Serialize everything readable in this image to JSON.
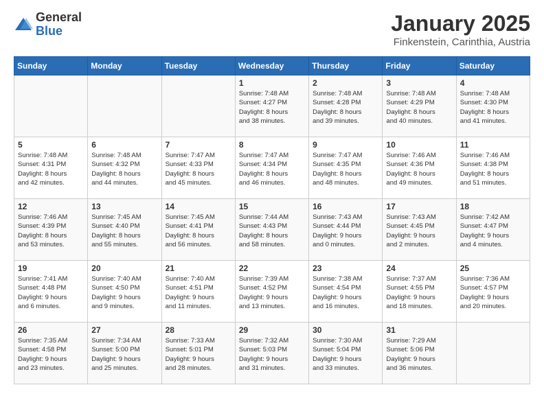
{
  "header": {
    "logo_general": "General",
    "logo_blue": "Blue",
    "title": "January 2025",
    "location": "Finkenstein, Carinthia, Austria"
  },
  "weekdays": [
    "Sunday",
    "Monday",
    "Tuesday",
    "Wednesday",
    "Thursday",
    "Friday",
    "Saturday"
  ],
  "weeks": [
    [
      {
        "day": "",
        "info": ""
      },
      {
        "day": "",
        "info": ""
      },
      {
        "day": "",
        "info": ""
      },
      {
        "day": "1",
        "info": "Sunrise: 7:48 AM\nSunset: 4:27 PM\nDaylight: 8 hours\nand 38 minutes."
      },
      {
        "day": "2",
        "info": "Sunrise: 7:48 AM\nSunset: 4:28 PM\nDaylight: 8 hours\nand 39 minutes."
      },
      {
        "day": "3",
        "info": "Sunrise: 7:48 AM\nSunset: 4:29 PM\nDaylight: 8 hours\nand 40 minutes."
      },
      {
        "day": "4",
        "info": "Sunrise: 7:48 AM\nSunset: 4:30 PM\nDaylight: 8 hours\nand 41 minutes."
      }
    ],
    [
      {
        "day": "5",
        "info": "Sunrise: 7:48 AM\nSunset: 4:31 PM\nDaylight: 8 hours\nand 42 minutes."
      },
      {
        "day": "6",
        "info": "Sunrise: 7:48 AM\nSunset: 4:32 PM\nDaylight: 8 hours\nand 44 minutes."
      },
      {
        "day": "7",
        "info": "Sunrise: 7:47 AM\nSunset: 4:33 PM\nDaylight: 8 hours\nand 45 minutes."
      },
      {
        "day": "8",
        "info": "Sunrise: 7:47 AM\nSunset: 4:34 PM\nDaylight: 8 hours\nand 46 minutes."
      },
      {
        "day": "9",
        "info": "Sunrise: 7:47 AM\nSunset: 4:35 PM\nDaylight: 8 hours\nand 48 minutes."
      },
      {
        "day": "10",
        "info": "Sunrise: 7:46 AM\nSunset: 4:36 PM\nDaylight: 8 hours\nand 49 minutes."
      },
      {
        "day": "11",
        "info": "Sunrise: 7:46 AM\nSunset: 4:38 PM\nDaylight: 8 hours\nand 51 minutes."
      }
    ],
    [
      {
        "day": "12",
        "info": "Sunrise: 7:46 AM\nSunset: 4:39 PM\nDaylight: 8 hours\nand 53 minutes."
      },
      {
        "day": "13",
        "info": "Sunrise: 7:45 AM\nSunset: 4:40 PM\nDaylight: 8 hours\nand 55 minutes."
      },
      {
        "day": "14",
        "info": "Sunrise: 7:45 AM\nSunset: 4:41 PM\nDaylight: 8 hours\nand 56 minutes."
      },
      {
        "day": "15",
        "info": "Sunrise: 7:44 AM\nSunset: 4:43 PM\nDaylight: 8 hours\nand 58 minutes."
      },
      {
        "day": "16",
        "info": "Sunrise: 7:43 AM\nSunset: 4:44 PM\nDaylight: 9 hours\nand 0 minutes."
      },
      {
        "day": "17",
        "info": "Sunrise: 7:43 AM\nSunset: 4:45 PM\nDaylight: 9 hours\nand 2 minutes."
      },
      {
        "day": "18",
        "info": "Sunrise: 7:42 AM\nSunset: 4:47 PM\nDaylight: 9 hours\nand 4 minutes."
      }
    ],
    [
      {
        "day": "19",
        "info": "Sunrise: 7:41 AM\nSunset: 4:48 PM\nDaylight: 9 hours\nand 6 minutes."
      },
      {
        "day": "20",
        "info": "Sunrise: 7:40 AM\nSunset: 4:50 PM\nDaylight: 9 hours\nand 9 minutes."
      },
      {
        "day": "21",
        "info": "Sunrise: 7:40 AM\nSunset: 4:51 PM\nDaylight: 9 hours\nand 11 minutes."
      },
      {
        "day": "22",
        "info": "Sunrise: 7:39 AM\nSunset: 4:52 PM\nDaylight: 9 hours\nand 13 minutes."
      },
      {
        "day": "23",
        "info": "Sunrise: 7:38 AM\nSunset: 4:54 PM\nDaylight: 9 hours\nand 16 minutes."
      },
      {
        "day": "24",
        "info": "Sunrise: 7:37 AM\nSunset: 4:55 PM\nDaylight: 9 hours\nand 18 minutes."
      },
      {
        "day": "25",
        "info": "Sunrise: 7:36 AM\nSunset: 4:57 PM\nDaylight: 9 hours\nand 20 minutes."
      }
    ],
    [
      {
        "day": "26",
        "info": "Sunrise: 7:35 AM\nSunset: 4:58 PM\nDaylight: 9 hours\nand 23 minutes."
      },
      {
        "day": "27",
        "info": "Sunrise: 7:34 AM\nSunset: 5:00 PM\nDaylight: 9 hours\nand 25 minutes."
      },
      {
        "day": "28",
        "info": "Sunrise: 7:33 AM\nSunset: 5:01 PM\nDaylight: 9 hours\nand 28 minutes."
      },
      {
        "day": "29",
        "info": "Sunrise: 7:32 AM\nSunset: 5:03 PM\nDaylight: 9 hours\nand 31 minutes."
      },
      {
        "day": "30",
        "info": "Sunrise: 7:30 AM\nSunset: 5:04 PM\nDaylight: 9 hours\nand 33 minutes."
      },
      {
        "day": "31",
        "info": "Sunrise: 7:29 AM\nSunset: 5:06 PM\nDaylight: 9 hours\nand 36 minutes."
      },
      {
        "day": "",
        "info": ""
      }
    ]
  ]
}
